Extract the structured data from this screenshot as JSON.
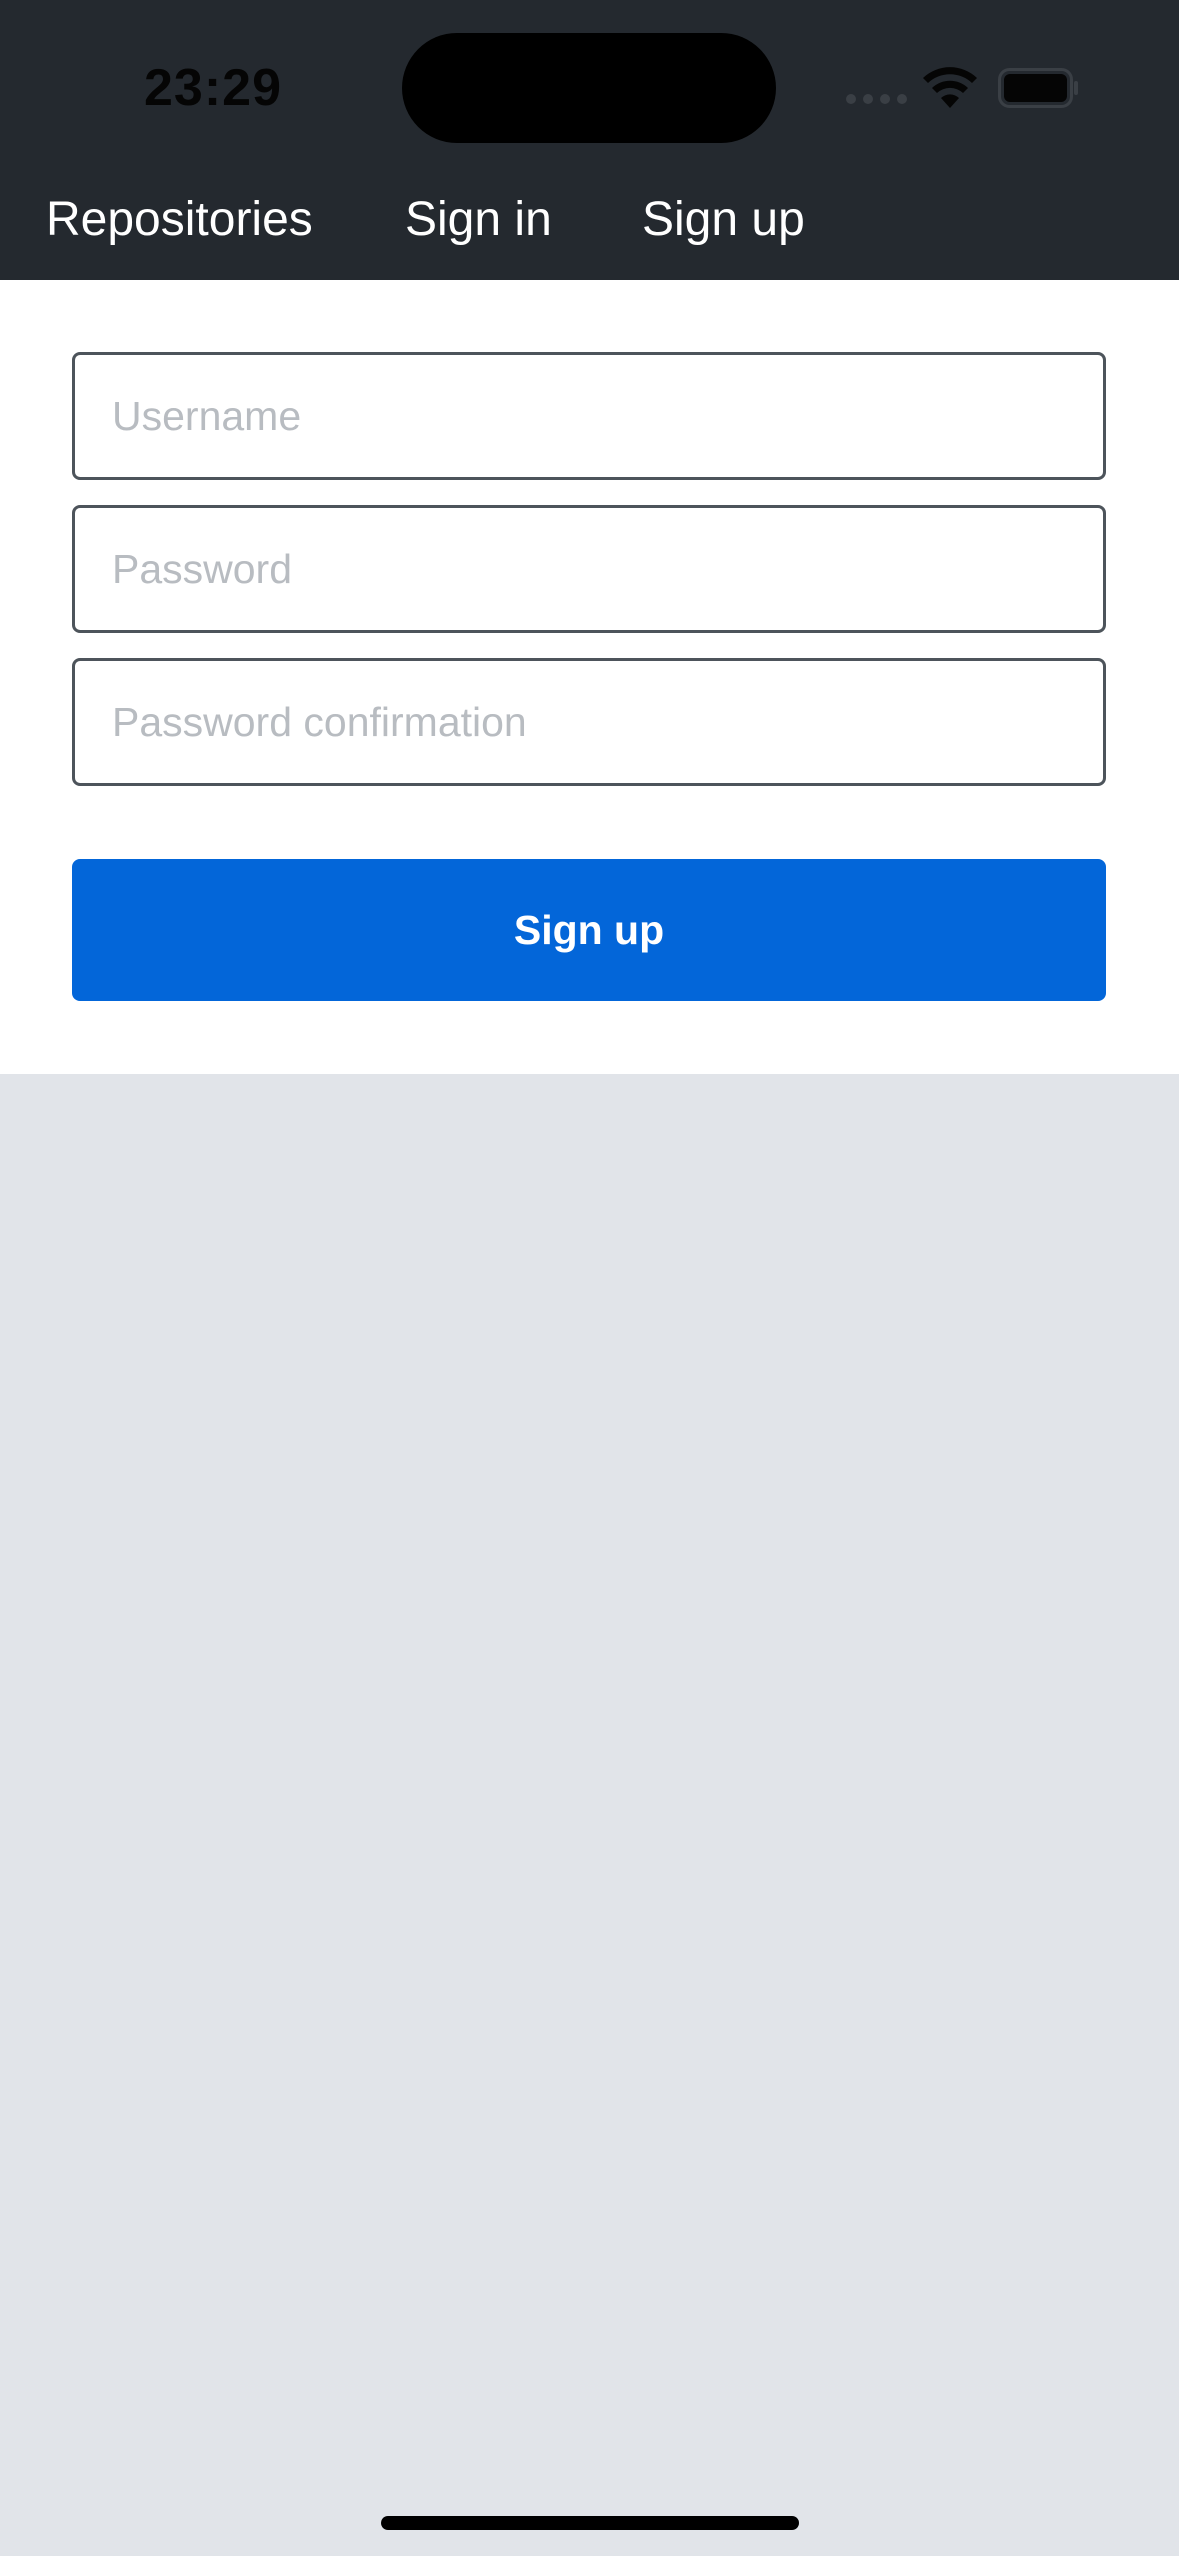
{
  "status_bar": {
    "time": "23:29"
  },
  "nav": {
    "items": [
      {
        "label": "Repositories"
      },
      {
        "label": "Sign in"
      },
      {
        "label": "Sign up"
      }
    ]
  },
  "form": {
    "username": {
      "value": "",
      "placeholder": "Username"
    },
    "password": {
      "value": "",
      "placeholder": "Password"
    },
    "password_confirmation": {
      "value": "",
      "placeholder": "Password confirmation"
    },
    "submit_label": "Sign up"
  },
  "colors": {
    "header_background": "#24292f",
    "primary_button": "#0366d9",
    "page_background": "#e1e4e9",
    "field_border": "#4d545b",
    "placeholder_text": "#b8bcc1"
  },
  "icons": {
    "wifi": "wifi-icon",
    "battery": "battery-icon",
    "signal": "cellular-signal-icon"
  }
}
